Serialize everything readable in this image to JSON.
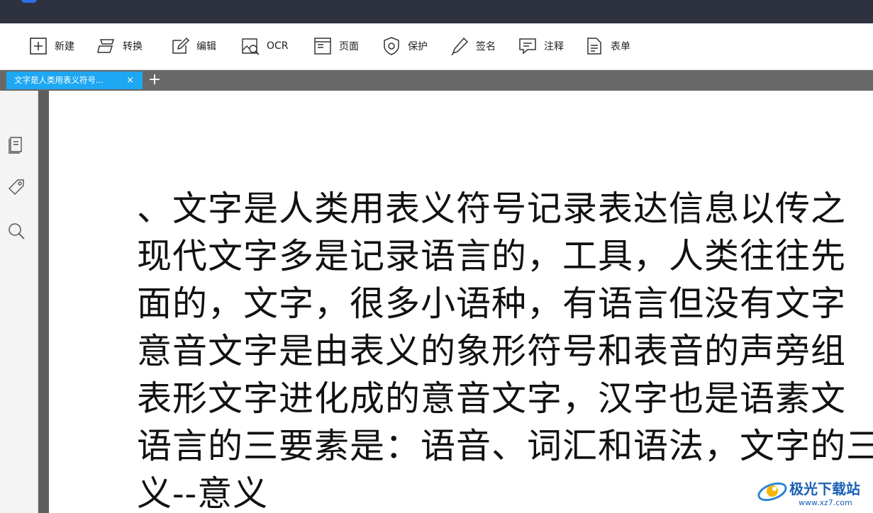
{
  "toolbar": {
    "items": [
      {
        "label": "新建",
        "icon": "new-icon"
      },
      {
        "label": "转换",
        "icon": "convert-icon"
      },
      {
        "label": "编辑",
        "icon": "edit-icon"
      },
      {
        "label": "OCR",
        "icon": "ocr-icon"
      },
      {
        "label": "页面",
        "icon": "page-icon"
      },
      {
        "label": "保护",
        "icon": "shield-icon"
      },
      {
        "label": "签名",
        "icon": "pen-icon"
      },
      {
        "label": "注释",
        "icon": "comment-icon"
      },
      {
        "label": "表单",
        "icon": "form-icon"
      }
    ]
  },
  "tabs": {
    "active": {
      "label": "文字是人类用表义符号...",
      "close": "×"
    },
    "add": "+"
  },
  "sidebar": {
    "icons": [
      "thumbnail-icon",
      "bookmark-tag-icon",
      "search-icon"
    ]
  },
  "document": {
    "lines": [
      "、文字是人类用表义符号记录表达信息以传之",
      "现代文字多是记录语言的，工具，人类往往先",
      "面的，文字，很多小语种，有语言但没有文字",
      "意音文字是由表义的象形符号和表音的声旁组",
      "表形文字进化成的意音文字，汉字也是语素文",
      "语言的三要素是：语音、词汇和语法，文字的三",
      "义--意义"
    ]
  },
  "watermark": {
    "title": "极光下载站",
    "url": "www.xz7.com"
  },
  "colors": {
    "titlebar": "#2e323e",
    "tab_active": "#1ea7f3",
    "tabbar": "#686868",
    "gutter": "#5e5e5e"
  }
}
